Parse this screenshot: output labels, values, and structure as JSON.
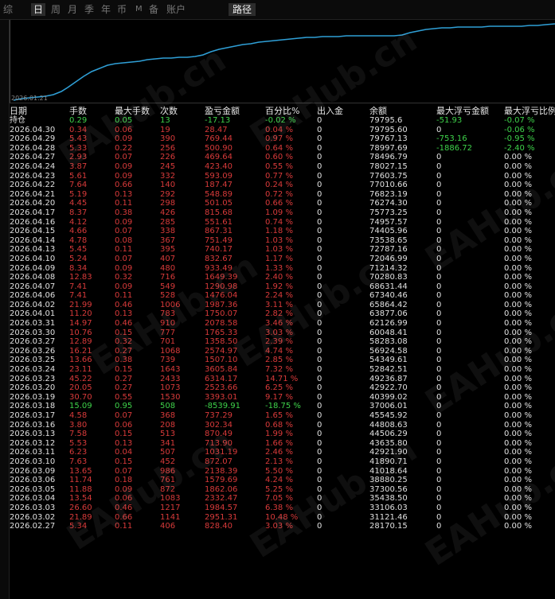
{
  "tabs": [
    "综",
    "日",
    "周",
    "月",
    "季",
    "年",
    "币",
    "M",
    "备",
    "账户"
  ],
  "path_tab": "路径",
  "chart": {
    "start_date": "2026.01.21",
    "line_color": "#2f9fd6"
  },
  "headers": {
    "date": "日期",
    "lots": "手数",
    "max_lots": "最大手数",
    "count": "次数",
    "pnl": "盈亏金额",
    "pct": "百分比%",
    "inout": "出入金",
    "balance": "余额",
    "max_float": "最大浮亏金额",
    "max_float_pct": "最大浮亏比例"
  },
  "holding": {
    "label": "持仓",
    "lots": "0.29",
    "max_lots": "0.05",
    "count": "13",
    "pnl": "-17.13",
    "pct": "-0.02 %",
    "inout": "0",
    "balance": "79795.6",
    "max_float": "-51.93",
    "max_float_pct": "-0.07 %"
  },
  "rows": [
    [
      "2026.04.30",
      "0.34",
      "0.06",
      "19",
      "28.47",
      "0.04 %",
      "0",
      "79795.60",
      "0",
      "-0.06 %"
    ],
    [
      "2026.04.29",
      "5.43",
      "0.09",
      "390",
      "769.44",
      "0.97 %",
      "0",
      "79767.13",
      "-753.16",
      "-0.95 %"
    ],
    [
      "2026.04.28",
      "5.33",
      "0.22",
      "256",
      "500.90",
      "0.64 %",
      "0",
      "78997.69",
      "-1886.72",
      "-2.40 %"
    ],
    [
      "2026.04.27",
      "2.93",
      "0.07",
      "226",
      "469.64",
      "0.60 %",
      "0",
      "78496.79",
      "0",
      "0.00 %"
    ],
    [
      "2026.04.24",
      "3.87",
      "0.09",
      "245",
      "423.40",
      "0.55 %",
      "0",
      "78027.15",
      "0",
      "0.00 %"
    ],
    [
      "2026.04.23",
      "5.61",
      "0.09",
      "332",
      "593.09",
      "0.77 %",
      "0",
      "77603.75",
      "0",
      "0.00 %"
    ],
    [
      "2026.04.22",
      "7.64",
      "0.66",
      "140",
      "187.47",
      "0.24 %",
      "0",
      "77010.66",
      "0",
      "0.00 %"
    ],
    [
      "2026.04.21",
      "5.19",
      "0.13",
      "292",
      "548.89",
      "0.72 %",
      "0",
      "76823.19",
      "0",
      "0.00 %"
    ],
    [
      "2026.04.20",
      "4.45",
      "0.11",
      "298",
      "501.05",
      "0.66 %",
      "0",
      "76274.30",
      "0",
      "0.00 %"
    ],
    [
      "2026.04.17",
      "8.37",
      "0.38",
      "426",
      "815.68",
      "1.09 %",
      "0",
      "75773.25",
      "0",
      "0.00 %"
    ],
    [
      "2026.04.16",
      "4.12",
      "0.09",
      "285",
      "551.61",
      "0.74 %",
      "0",
      "74957.57",
      "0",
      "0.00 %"
    ],
    [
      "2026.04.15",
      "4.66",
      "0.07",
      "338",
      "867.31",
      "1.18 %",
      "0",
      "74405.96",
      "0",
      "0.00 %"
    ],
    [
      "2026.04.14",
      "4.78",
      "0.08",
      "367",
      "751.49",
      "1.03 %",
      "0",
      "73538.65",
      "0",
      "0.00 %"
    ],
    [
      "2026.04.13",
      "5.45",
      "0.11",
      "395",
      "740.17",
      "1.03 %",
      "0",
      "72787.16",
      "0",
      "0.00 %"
    ],
    [
      "2026.04.10",
      "5.24",
      "0.07",
      "407",
      "832.67",
      "1.17 %",
      "0",
      "72046.99",
      "0",
      "0.00 %"
    ],
    [
      "2026.04.09",
      "8.34",
      "0.09",
      "480",
      "933.49",
      "1.33 %",
      "0",
      "71214.32",
      "0",
      "0.00 %"
    ],
    [
      "2026.04.08",
      "12.83",
      "0.32",
      "716",
      "1649.39",
      "2.40 %",
      "0",
      "70280.83",
      "0",
      "0.00 %"
    ],
    [
      "2026.04.07",
      "7.41",
      "0.09",
      "549",
      "1290.98",
      "1.92 %",
      "0",
      "68631.44",
      "0",
      "0.00 %"
    ],
    [
      "2026.04.06",
      "7.41",
      "0.11",
      "528",
      "1476.04",
      "2.24 %",
      "0",
      "67340.46",
      "0",
      "0.00 %"
    ],
    [
      "2026.04.02",
      "21.99",
      "0.46",
      "1006",
      "1987.36",
      "3.11 %",
      "0",
      "65864.42",
      "0",
      "0.00 %"
    ],
    [
      "2026.04.01",
      "11.20",
      "0.13",
      "783",
      "1750.07",
      "2.82 %",
      "0",
      "63877.06",
      "0",
      "0.00 %"
    ],
    [
      "2026.03.31",
      "14.97",
      "0.46",
      "910",
      "2078.58",
      "3.46 %",
      "0",
      "62126.99",
      "0",
      "0.00 %"
    ],
    [
      "2026.03.30",
      "10.76",
      "0.15",
      "777",
      "1765.33",
      "3.03 %",
      "0",
      "60048.41",
      "0",
      "0.00 %"
    ],
    [
      "2026.03.27",
      "12.89",
      "0.32",
      "701",
      "1358.50",
      "2.39 %",
      "0",
      "58283.08",
      "0",
      "0.00 %"
    ],
    [
      "2026.03.26",
      "16.21",
      "0.27",
      "1068",
      "2574.97",
      "4.74 %",
      "0",
      "56924.58",
      "0",
      "0.00 %"
    ],
    [
      "2026.03.25",
      "13.66",
      "0.38",
      "739",
      "1507.10",
      "2.85 %",
      "0",
      "54349.61",
      "0",
      "0.00 %"
    ],
    [
      "2026.03.24",
      "23.11",
      "0.15",
      "1643",
      "3605.84",
      "7.32 %",
      "0",
      "52842.51",
      "0",
      "0.00 %"
    ],
    [
      "2026.03.23",
      "45.22",
      "0.27",
      "2433",
      "6314.17",
      "14.71 %",
      "0",
      "49236.87",
      "0",
      "0.00 %"
    ],
    [
      "2026.03.20",
      "20.05",
      "0.27",
      "1073",
      "2523.66",
      "6.25 %",
      "0",
      "42922.70",
      "0",
      "0.00 %"
    ],
    [
      "2026.03.19",
      "30.70",
      "0.55",
      "1530",
      "3393.01",
      "9.17 %",
      "0",
      "40399.02",
      "0",
      "0.00 %"
    ],
    [
      "2026.03.18",
      "15.09",
      "0.95",
      "508",
      "-8539.91",
      "-18.75 %",
      "0",
      "37006.01",
      "0",
      "0.00 %"
    ],
    [
      "2026.03.17",
      "4.58",
      "0.07",
      "368",
      "737.29",
      "1.65 %",
      "0",
      "45545.92",
      "0",
      "0.00 %"
    ],
    [
      "2026.03.16",
      "3.80",
      "0.06",
      "208",
      "302.34",
      "0.68 %",
      "0",
      "44808.63",
      "0",
      "0.00 %"
    ],
    [
      "2026.03.13",
      "7.58",
      "0.15",
      "513",
      "870.49",
      "1.99 %",
      "0",
      "44506.29",
      "0",
      "0.00 %"
    ],
    [
      "2026.03.12",
      "5.53",
      "0.13",
      "341",
      "713.90",
      "1.66 %",
      "0",
      "43635.80",
      "0",
      "0.00 %"
    ],
    [
      "2026.03.11",
      "6.23",
      "0.04",
      "507",
      "1031.19",
      "2.46 %",
      "0",
      "42921.90",
      "0",
      "0.00 %"
    ],
    [
      "2026.03.10",
      "7.63",
      "0.15",
      "452",
      "872.07",
      "2.13 %",
      "0",
      "41890.71",
      "0",
      "0.00 %"
    ],
    [
      "2026.03.09",
      "13.65",
      "0.07",
      "986",
      "2138.39",
      "5.50 %",
      "0",
      "41018.64",
      "0",
      "0.00 %"
    ],
    [
      "2026.03.06",
      "11.74",
      "0.18",
      "761",
      "1579.69",
      "4.24 %",
      "0",
      "38880.25",
      "0",
      "0.00 %"
    ],
    [
      "2026.03.05",
      "11.88",
      "0.09",
      "872",
      "1862.06",
      "5.25 %",
      "0",
      "37300.56",
      "0",
      "0.00 %"
    ],
    [
      "2026.03.04",
      "13.54",
      "0.06",
      "1083",
      "2332.47",
      "7.05 %",
      "0",
      "35438.50",
      "0",
      "0.00 %"
    ],
    [
      "2026.03.03",
      "26.60",
      "0.46",
      "1217",
      "1984.57",
      "6.38 %",
      "0",
      "33106.03",
      "0",
      "0.00 %"
    ],
    [
      "2026.03.02",
      "21.89",
      "0.66",
      "1141",
      "2951.31",
      "10.48 %",
      "0",
      "31121.46",
      "0",
      "0.00 %"
    ],
    [
      "2026.02.27",
      "5.34",
      "0.11",
      "406",
      "828.40",
      "3.03 %",
      "0",
      "28170.15",
      "0",
      "0.00 %"
    ]
  ],
  "watermark": "EAHub.cn"
}
